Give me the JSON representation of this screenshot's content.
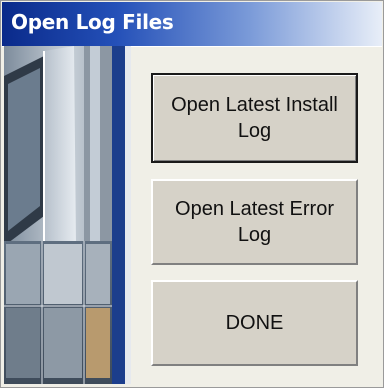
{
  "window": {
    "title": "Open Log Files"
  },
  "buttons": {
    "install_log": {
      "line1": "Open Latest Install",
      "line2": "Log"
    },
    "error_log": {
      "line1": "Open Latest Error",
      "line2": "Log"
    },
    "done": {
      "label": "DONE"
    }
  },
  "colors": {
    "title_start": "#0a2a8a",
    "title_end": "#e8eef8",
    "button_face": "#d6d2c8",
    "window_bg": "#f0efe7"
  }
}
